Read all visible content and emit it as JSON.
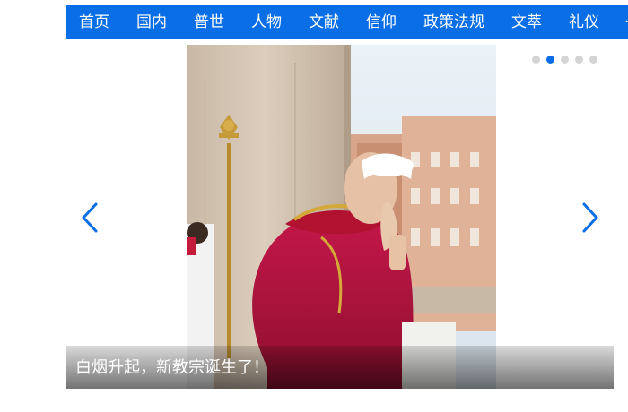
{
  "nav": {
    "items": [
      {
        "label": "首页"
      },
      {
        "label": "国内"
      },
      {
        "label": "普世"
      },
      {
        "label": "人物"
      },
      {
        "label": "文献"
      },
      {
        "label": "信仰"
      },
      {
        "label": "政策法规"
      },
      {
        "label": "文萃"
      },
      {
        "label": "礼仪"
      }
    ]
  },
  "carousel": {
    "caption": "白烟升起，新教宗诞生了！",
    "active_dot": 2,
    "dot_count": 5,
    "prev_icon": "chevron-left-icon",
    "next_icon": "chevron-right-icon",
    "colors": {
      "accent": "#0a6fe6",
      "dot_inactive": "#d4d4d4",
      "vestment": "#b5123a"
    }
  }
}
